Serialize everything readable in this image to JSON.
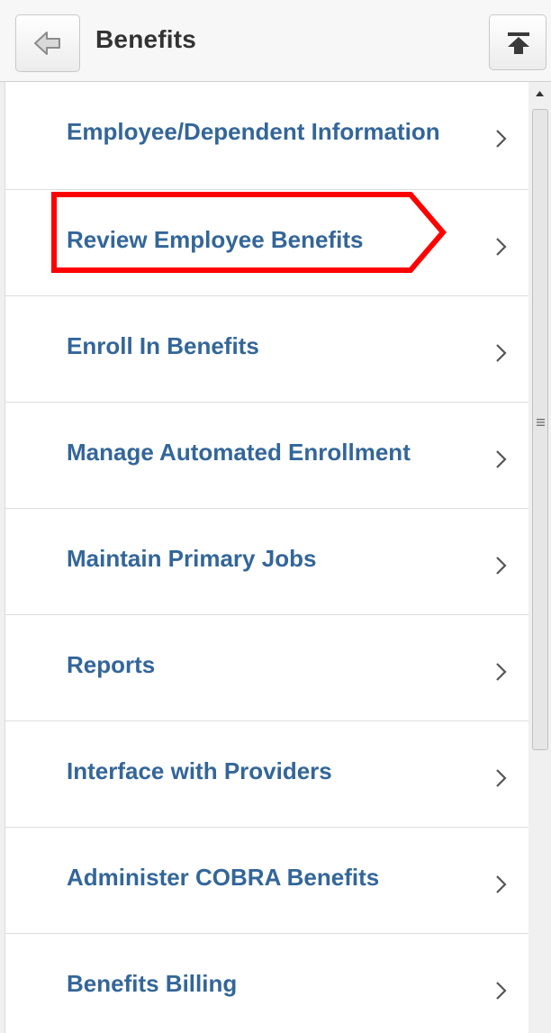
{
  "header": {
    "title": "Benefits",
    "back_icon": "back-arrow-icon",
    "top_icon": "scroll-to-top-icon"
  },
  "menu": {
    "items": [
      {
        "label": "Employee/Dependent Information"
      },
      {
        "label": "Review Employee Benefits"
      },
      {
        "label": "Enroll In Benefits"
      },
      {
        "label": "Manage Automated Enrollment"
      },
      {
        "label": "Maintain Primary Jobs"
      },
      {
        "label": "Reports"
      },
      {
        "label": "Interface with Providers"
      },
      {
        "label": "Administer COBRA Benefits"
      },
      {
        "label": "Benefits Billing"
      }
    ],
    "highlighted_item": "Review Employee Benefits"
  },
  "colors": {
    "link": "#336699",
    "title": "#333333",
    "highlight": "#ff0000"
  }
}
